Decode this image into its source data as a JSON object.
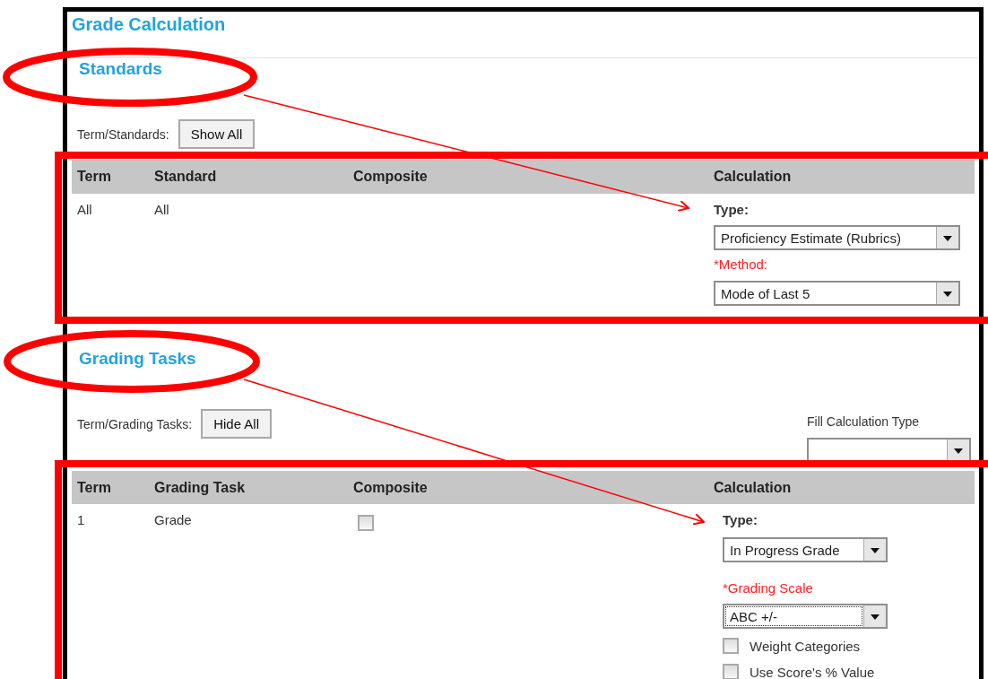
{
  "page_title": "Grade Calculation",
  "sections": [
    {
      "heading": "Standards",
      "toolbar": {
        "label": "Term/Standards:",
        "button": "Show All"
      },
      "columns": [
        "Term",
        "Standard",
        "Composite",
        "Calculation"
      ],
      "rows": [
        {
          "term": "All",
          "item": "All",
          "calculation": [
            {
              "kind": "label",
              "text": "Type:"
            },
            {
              "kind": "select",
              "value": "Proficiency Estimate (Rubrics)",
              "focused": false
            },
            {
              "kind": "required-label",
              "text": "*Method:"
            },
            {
              "kind": "select",
              "value": "Mode of Last 5",
              "focused": false
            }
          ]
        }
      ]
    },
    {
      "heading": "Grading Tasks",
      "toolbar": {
        "label": "Term/Grading Tasks:",
        "button": "Hide All",
        "fill_label": "Fill Calculation Type"
      },
      "columns": [
        "Term",
        "Grading Task",
        "Composite",
        "Calculation"
      ],
      "rows": [
        {
          "term": "1",
          "item": "Grade",
          "composite": {
            "checked": false
          },
          "calculation": [
            {
              "kind": "label",
              "text": "Type:"
            },
            {
              "kind": "select",
              "value": "In Progress Grade",
              "focused": false
            },
            {
              "kind": "required-label",
              "text": "*Grading Scale"
            },
            {
              "kind": "select",
              "value": "ABC +/-",
              "focused": true
            },
            {
              "kind": "checkbox",
              "text": "Weight Categories",
              "checked": false
            },
            {
              "kind": "checkbox",
              "text": "Use Score's % Value",
              "checked": false
            }
          ]
        }
      ]
    }
  ]
}
